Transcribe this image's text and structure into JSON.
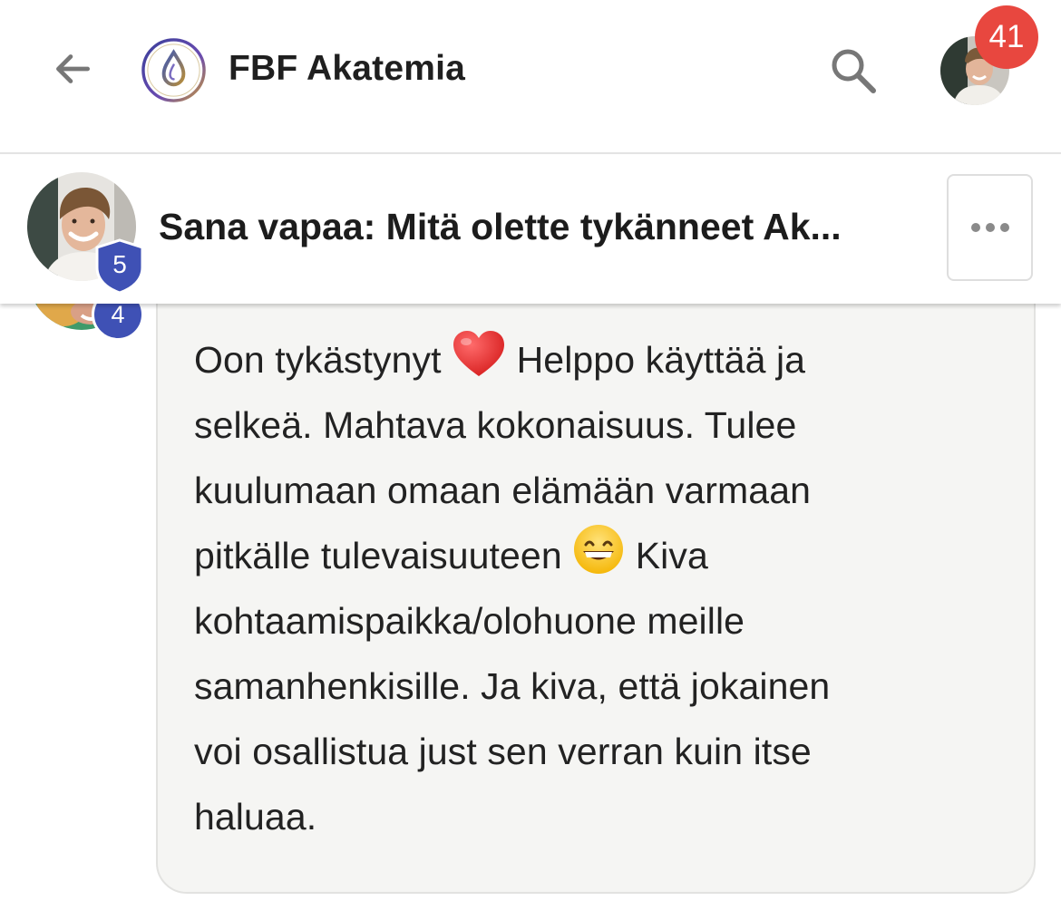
{
  "appbar": {
    "back_icon": "arrow-left-icon",
    "brand_name": "FBF Akatemia",
    "search_icon": "search-icon",
    "notification_count": "41",
    "colors": {
      "badge": "#e8473f",
      "text": "#1f1f1f",
      "icon": "#777777"
    }
  },
  "topic": {
    "title": "Sana vapaa: Mitä olette tykänneet Ak...",
    "author_trust_level": "5",
    "more_icon": "more-horizontal-icon"
  },
  "post": {
    "author_trust_level": "4",
    "lines": [
      {
        "before": "Oon tykästynyt",
        "emoji": "heart-emoji",
        "after": "Helppo käyttää ja"
      },
      {
        "text": "selkeä. Mahtava kokonaisuus. Tulee"
      },
      {
        "text": "kuulumaan omaan elämään varmaan"
      },
      {
        "before": "pitkälle tulevaisuuteen",
        "emoji": "grinning-face-emoji",
        "after": "Kiva"
      },
      {
        "text": "kohtaamispaikka/olohuone meille"
      },
      {
        "text": "samanhenkisille. Ja kiva, että jokainen"
      },
      {
        "text": "voi osallistua just sen verran kuin itse"
      },
      {
        "text": "haluaa."
      }
    ],
    "colors": {
      "bubble_bg": "#f5f5f3",
      "shield": "#3f51b5"
    }
  }
}
